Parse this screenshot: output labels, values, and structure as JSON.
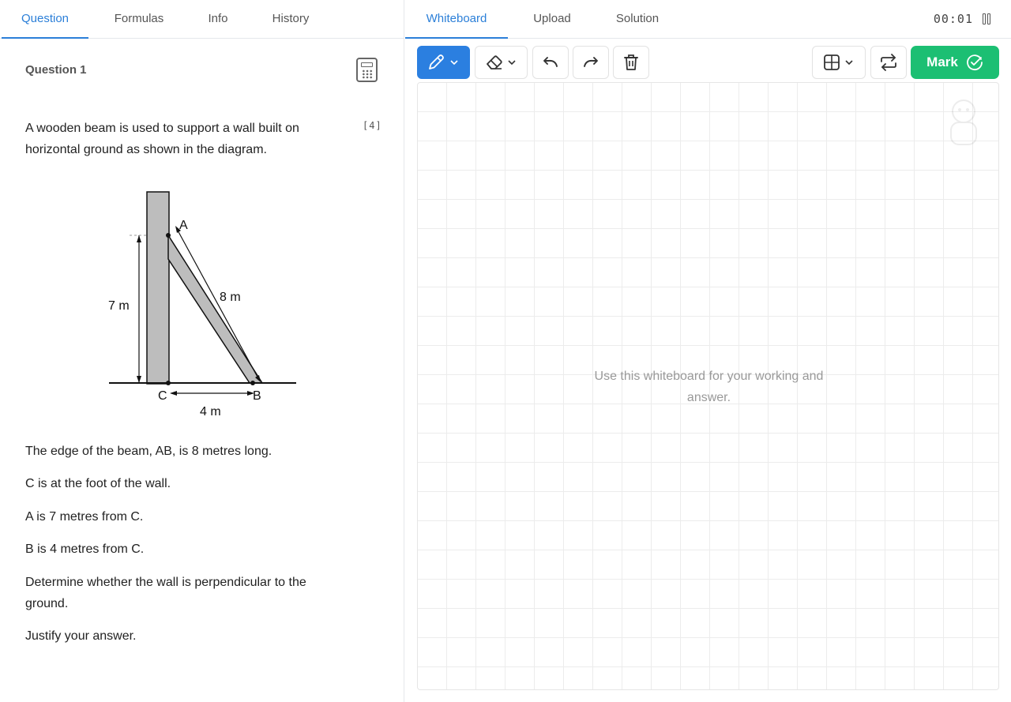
{
  "left_tabs": [
    {
      "label": "Question",
      "active": true
    },
    {
      "label": "Formulas",
      "active": false
    },
    {
      "label": "Info",
      "active": false
    },
    {
      "label": "History",
      "active": false
    }
  ],
  "right_tabs": [
    {
      "label": "Whiteboard",
      "active": true
    },
    {
      "label": "Upload",
      "active": false
    },
    {
      "label": "Solution",
      "active": false
    }
  ],
  "timer": "00:01",
  "question": {
    "title": "Question 1",
    "marks": "[4]",
    "intro": [
      "A wooden beam is used to support a wall built on",
      "horizontal ground as shown in the diagram."
    ],
    "statements": [
      "The edge of the beam, AB, is 8 metres long.",
      "C is at the foot of the wall.",
      "A is 7 metres from C.",
      "B is 4 metres from C."
    ],
    "task": [
      "Determine whether the wall is perpendicular to the",
      "ground."
    ],
    "justify": "Justify your answer."
  },
  "diagram": {
    "label_a": "A",
    "label_b": "B",
    "label_c": "C",
    "label_ab": "8 m",
    "label_ac": "7 m",
    "label_cb": "4 m"
  },
  "toolbar": {
    "mark_label": "Mark",
    "pen_color": "#2b7fe0",
    "mark_color": "#1cbf73",
    "icons": [
      "pencil-icon",
      "eraser-icon",
      "undo-icon",
      "redo-icon",
      "trash-icon",
      "grid-icon",
      "swap-icon",
      "check-circle-icon"
    ]
  },
  "whiteboard": {
    "hint": [
      "Use this whiteboard for your working and",
      "answer."
    ]
  },
  "colors": {
    "accent": "#2b7fd8",
    "success": "#1cbf73"
  }
}
